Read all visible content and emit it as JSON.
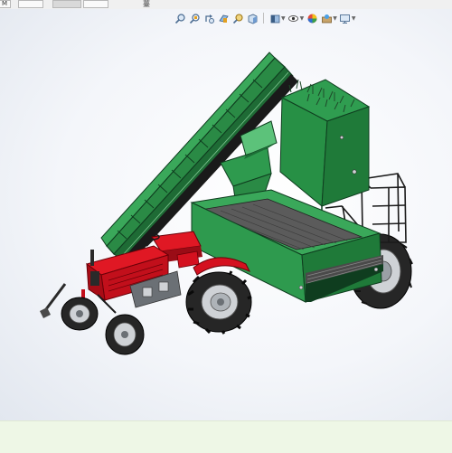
{
  "top_strip": {
    "tab_label": "M",
    "menu_label": "薹"
  },
  "heads_up_toolbar": {
    "icons": [
      "zoom-to-fit-icon",
      "zoom-to-area-icon",
      "previous-view-icon",
      "section-view-icon",
      "dynamic-annotation-icon",
      "view-orientation-icon",
      "display-style-icon",
      "hide-show-items-icon",
      "edit-appearance-icon",
      "apply-scene-icon",
      "view-settings-icon"
    ]
  },
  "model": {
    "name": "sugarcane-harvester-assembly",
    "colors": {
      "tractor_body": "#d4111f",
      "tractor_dark": "#8a0a12",
      "bin_green": "#2e9a4e",
      "bin_green_dark": "#1c6e36",
      "conveyor_green": "#2a8a45",
      "tire": "#2a2a2a",
      "rim": "#cfd2d6",
      "frame": "#1a1a1a",
      "background_status": "#eef7e6"
    }
  }
}
